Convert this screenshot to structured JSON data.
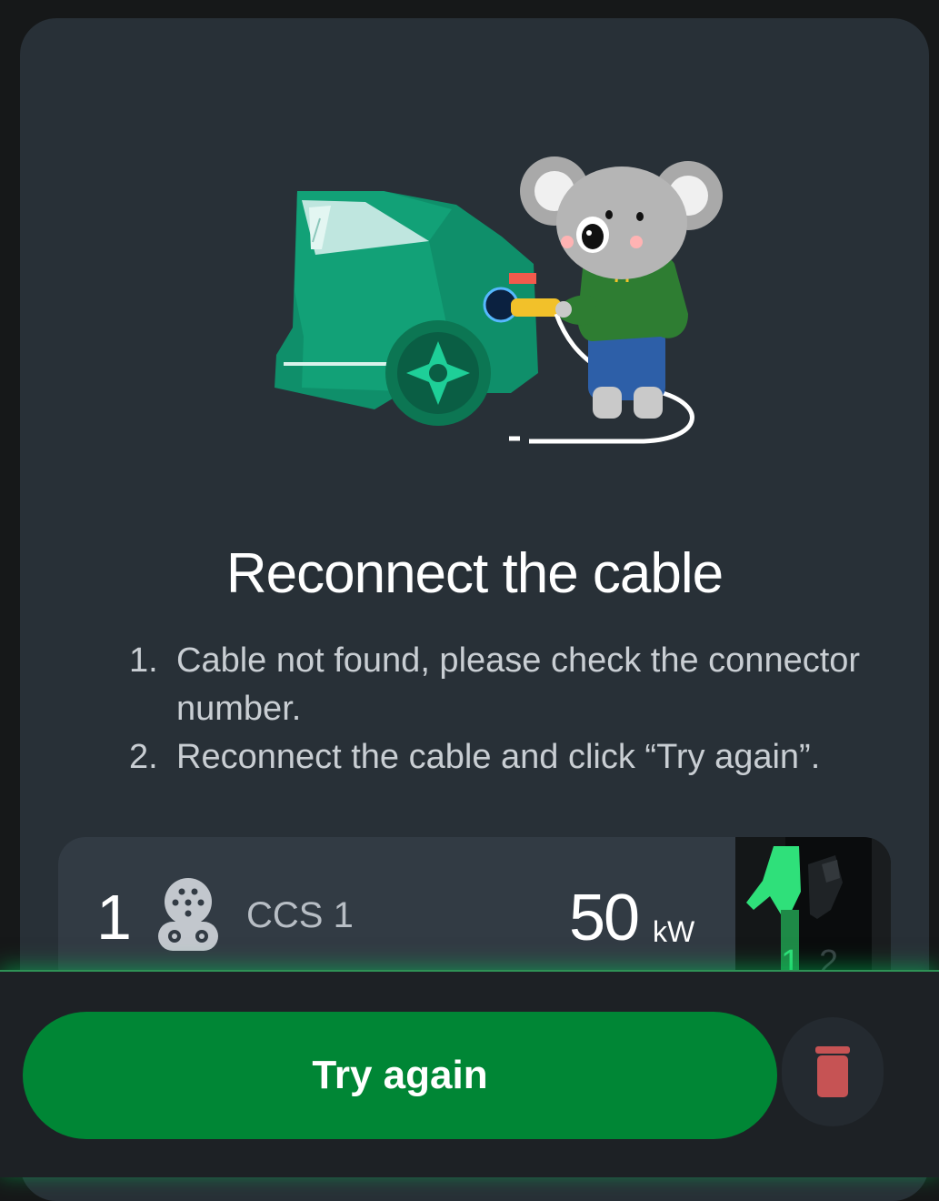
{
  "error": {
    "title": "Reconnect the cable",
    "steps": [
      {
        "num": "1.",
        "text": "Cable not found, please check the connector number."
      },
      {
        "num": "2.",
        "text": "Reconnect the cable and click “Try again”."
      }
    ]
  },
  "connector": {
    "number": "1",
    "icon": "ccs1-plug-icon",
    "type": "CCS 1",
    "power": "50",
    "power_unit": "kW",
    "photo_labels": [
      "1",
      "2"
    ]
  },
  "actions": {
    "try_again_label": "Try again",
    "delete_icon": "trash-icon"
  },
  "colors": {
    "background": "#161819",
    "card": "#283037",
    "primary": "#008635",
    "highlight": "#2fe07a",
    "danger": "#e35b5b"
  }
}
